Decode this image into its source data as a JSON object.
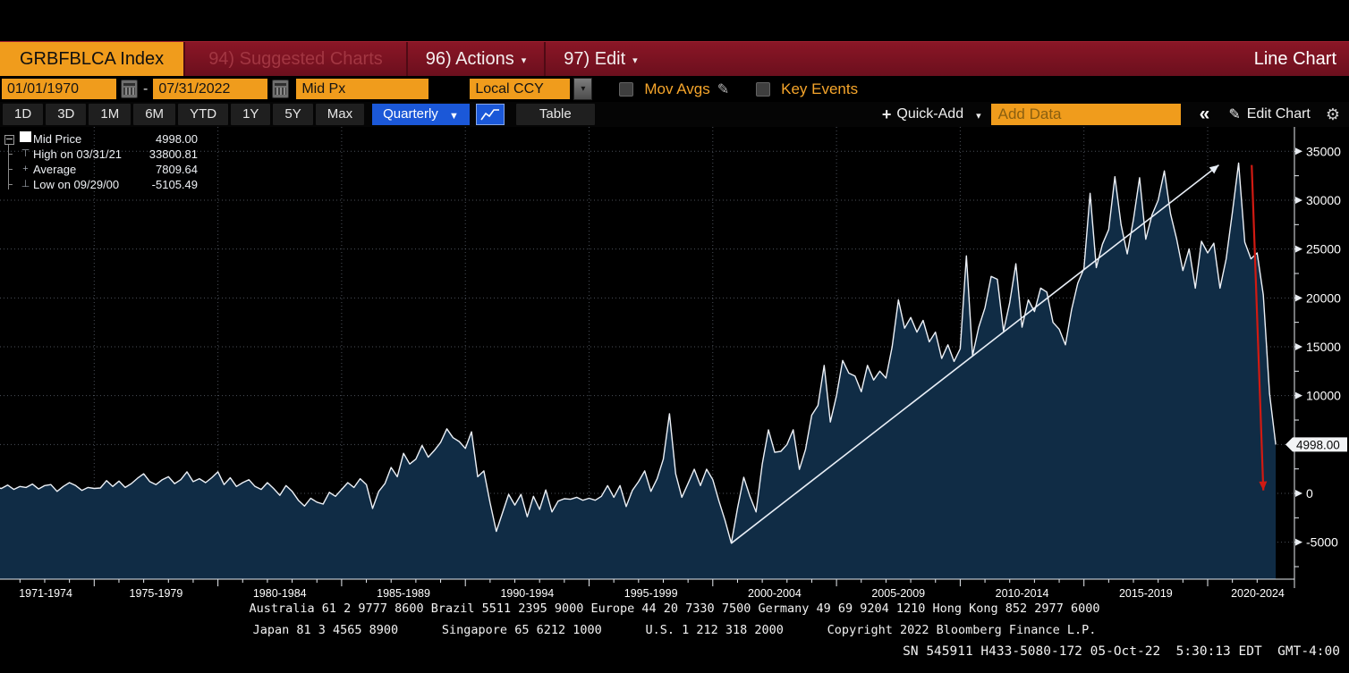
{
  "titlebar": {
    "ticker_tab": "GRBFBLCA Index",
    "suggested_charts": "94) Suggested Charts",
    "actions": "96) Actions",
    "edit": "97) Edit",
    "caret": "▾",
    "view_label": "Line Chart"
  },
  "settings": {
    "date_from": "01/01/1970",
    "separator": "-",
    "date_to": "07/31/2022",
    "price_type": "Mid Px",
    "currency": "Local CCY",
    "dropdown_caret": "▾",
    "mov_avgs_label": "Mov Avgs",
    "key_events_label": "Key Events",
    "pencil_icon": "✎"
  },
  "toolbar": {
    "ranges": [
      "1D",
      "3D",
      "1M",
      "6M",
      "YTD",
      "1Y",
      "5Y",
      "Max"
    ],
    "period_selected": "Quarterly",
    "period_caret": "▼",
    "table_label": "Table",
    "quick_add_plus": "+",
    "quick_add_label": "Quick-Add",
    "quick_add_caret": "▾",
    "add_data_value": "Add Data",
    "collapse_label": "«",
    "edit_chart_pencil": "✎",
    "edit_chart_label": "Edit Chart",
    "gear_icon": "⚙"
  },
  "legend": {
    "items": [
      {
        "icon": "white-square-swatch",
        "label": "Mid Price",
        "value": "4998.00"
      },
      {
        "icon": "high-whisker-marker",
        "label": "High on 03/31/21",
        "value": "33800.81"
      },
      {
        "icon": "average-marker",
        "label": "Average",
        "value": "7809.64"
      },
      {
        "icon": "low-whisker-marker",
        "label": "Low on 09/29/00",
        "value": "-5105.49"
      }
    ],
    "icon_glyphs": {
      "high-whisker-marker": "⊤",
      "average-marker": "+",
      "low-whisker-marker": "⊥"
    }
  },
  "chart_data": {
    "type": "area",
    "title": "GRBFBLCA Index — Mid Px, Quarterly, Local CCY",
    "x_start_year": 1970,
    "frequency": "quarterly",
    "values": [
      400,
      700,
      250,
      600,
      500,
      850,
      400,
      700,
      600,
      950,
      450,
      800,
      900,
      200,
      700,
      1100,
      800,
      300,
      600,
      500,
      550,
      1300,
      700,
      1250,
      600,
      1000,
      1550,
      2000,
      1200,
      900,
      1400,
      1700,
      1000,
      1400,
      2200,
      1200,
      1500,
      1100,
      1600,
      2200,
      900,
      1600,
      700,
      1100,
      1400,
      700,
      400,
      1100,
      500,
      -200,
      800,
      200,
      -700,
      -1300,
      -500,
      -900,
      -1100,
      100,
      -300,
      400,
      1100,
      600,
      1500,
      900,
      -1550,
      200,
      1000,
      2650,
      1700,
      4100,
      3000,
      3500,
      4900,
      3700,
      4400,
      5200,
      6600,
      5700,
      5300,
      4600,
      6300,
      1700,
      2300,
      -1000,
      -3900,
      -2000,
      -100,
      -1200,
      -100,
      -2400,
      -300,
      -1650,
      350,
      -1900,
      -800,
      -550,
      -600,
      -400,
      -700,
      -500,
      -700,
      -300,
      800,
      -400,
      800,
      -1350,
      300,
      1200,
      2300,
      200,
      1500,
      3500,
      8150,
      2000,
      -400,
      1000,
      2470,
      800,
      2470,
      1400,
      -800,
      -2800,
      -5105.49,
      -1500,
      1650,
      -300,
      -1900,
      3000,
      6500,
      4200,
      4300,
      5000,
      6500,
      2450,
      4500,
      8000,
      9000,
      13100,
      7300,
      10000,
      13600,
      12300,
      12000,
      10400,
      13100,
      11600,
      12500,
      11800,
      15000,
      19800,
      16900,
      18000,
      16500,
      17700,
      15500,
      16500,
      13800,
      15200,
      13500,
      14800,
      24300,
      14100,
      17000,
      19000,
      22200,
      21900,
      16600,
      19500,
      23500,
      17000,
      19800,
      18600,
      21000,
      20600,
      17500,
      16800,
      15200,
      18800,
      21500,
      23000,
      30700,
      23100,
      25500,
      27000,
      32400,
      27500,
      24500,
      28000,
      32300,
      26000,
      28500,
      30000,
      33000,
      28600,
      26000,
      22800,
      25000,
      21000,
      25800,
      24600,
      25600,
      21000,
      24000,
      28800,
      33800.81,
      25700,
      24000,
      24600,
      20300,
      10200,
      4998
    ],
    "ylim": [
      -8780,
      37500
    ],
    "yticks": [
      -5000,
      0,
      5000,
      10000,
      15000,
      20000,
      25000,
      30000,
      35000
    ],
    "ytick_labels": [
      "-5000",
      "0",
      "",
      "10000",
      "15000",
      "20000",
      "25000",
      "30000",
      "35000"
    ],
    "gridline_years": [
      1975,
      1980,
      1985,
      1990,
      1995,
      2000,
      2005,
      2010,
      2015,
      2020
    ],
    "xlabels": [
      {
        "text": "1971-1974",
        "year_center": 1973.04
      },
      {
        "text": "1975-1979",
        "year_center": 1977.5
      },
      {
        "text": "1980-1984",
        "year_center": 1982.5
      },
      {
        "text": "1985-1989",
        "year_center": 1987.5
      },
      {
        "text": "1990-1994",
        "year_center": 1992.5
      },
      {
        "text": "1995-1999",
        "year_center": 1997.5
      },
      {
        "text": "2000-2004",
        "year_center": 2002.5
      },
      {
        "text": "2005-2009",
        "year_center": 2007.5
      },
      {
        "text": "2010-2014",
        "year_center": 2012.5
      },
      {
        "text": "2015-2019",
        "year_center": 2017.5
      },
      {
        "text": "2020-2024",
        "year_center": 2022.5
      }
    ],
    "last_price_label": "4998.00",
    "high": {
      "date": "03/31/21",
      "value": 33800.81
    },
    "low": {
      "date": "09/29/00",
      "value": -5105.49
    },
    "average": 7809.64,
    "annotations": [
      {
        "name": "uptrend-arrow",
        "color": "#e8eef6",
        "width": 1.6,
        "from": {
          "year": 2000.75,
          "value": -5105
        },
        "to": {
          "year": 2020.45,
          "value": 33600
        }
      },
      {
        "name": "drop-arrow",
        "color": "#d11a12",
        "width": 2.2,
        "from": {
          "year": 2021.78,
          "value": 33600
        },
        "to": {
          "year": 2022.25,
          "value": 300
        }
      }
    ],
    "colors": {
      "line": "#edf1f7",
      "fill": "#102c45",
      "grid": "#7d8794",
      "axis": "#e8ecf1",
      "tag_bg": "#f2f4f6",
      "tag_text": "#0a0a0a"
    }
  },
  "footer": {
    "line1": "Australia 61 2 9777 8600 Brazil 5511 2395 9000 Europe 44 20 7330 7500 Germany 49 69 9204 1210 Hong Kong 852 2977 6000",
    "line2": "Japan 81 3 4565 8900      Singapore 65 6212 1000      U.S. 1 212 318 2000      Copyright 2022 Bloomberg Finance L.P.",
    "line3": "SN 545911 H433-5080-172 05-Oct-22  5:30:13 EDT  GMT-4:00"
  }
}
